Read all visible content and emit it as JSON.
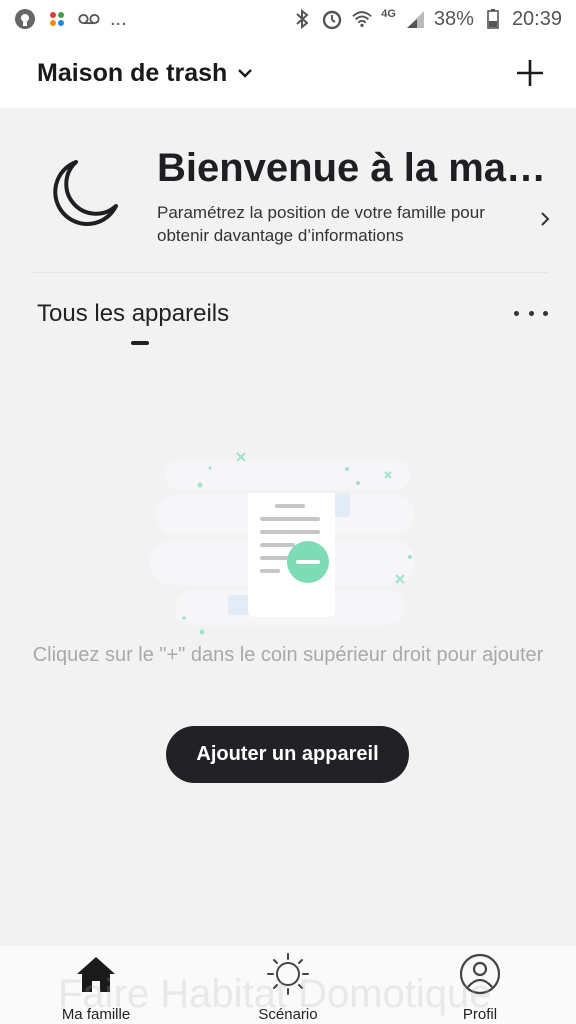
{
  "status_bar": {
    "left_icons": [
      "assistant-icon",
      "app-icon",
      "voicemail-icon"
    ],
    "more": "...",
    "right_icons": [
      "bluetooth-icon",
      "alarm-icon",
      "wifi-icon",
      "signal-icon",
      "battery-icon"
    ],
    "network": "4G",
    "battery": "38%",
    "time": "20:39"
  },
  "header": {
    "home_name": "Maison de trash",
    "add_icon": "plus-icon"
  },
  "welcome": {
    "title": "Bienvenue à la mai...",
    "subtitle": "Paramétrez la position de votre famille pour obtenir davantage d’informations",
    "icon": "moon-icon"
  },
  "devices_section": {
    "title": "Tous les appareils",
    "more_icon": "more-icon"
  },
  "empty_state": {
    "message": "Cliquez sur le \"+\" dans le coin supérieur droit pour ajouter",
    "button": "Ajouter un appareil"
  },
  "bottom_nav": {
    "items": [
      {
        "label": "Ma famille",
        "icon": "home-icon"
      },
      {
        "label": "Scénario",
        "icon": "sun-icon"
      },
      {
        "label": "Profil",
        "icon": "profile-icon"
      }
    ]
  },
  "watermark": "Faire Habitat Domotique",
  "colors": {
    "accent_green": "#7ddbb5",
    "dark": "#222226",
    "background": "#f2f2f2"
  }
}
